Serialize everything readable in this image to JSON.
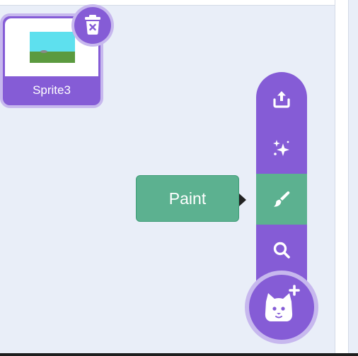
{
  "sprite_list": {
    "selected_sprite": {
      "name": "Sprite3",
      "thumbnail_icon": "landscape-thumbnail"
    },
    "delete_icon": "trash-icon"
  },
  "add_sprite_menu": {
    "items": [
      {
        "icon": "upload-icon",
        "active": false
      },
      {
        "icon": "sparkles-icon",
        "active": false
      },
      {
        "icon": "paintbrush-icon",
        "active": true
      },
      {
        "icon": "search-icon",
        "active": false
      }
    ],
    "main_button_icon": "cat-add-icon",
    "tooltip_label": "Paint"
  },
  "colors": {
    "accent_purple": "#855cd6",
    "light_purple": "#c7b8ee",
    "active_green": "#5cb190",
    "background": "#e9eef8"
  }
}
